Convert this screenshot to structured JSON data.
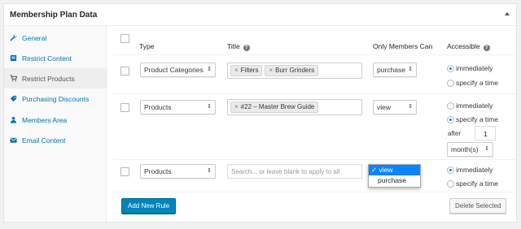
{
  "panel": {
    "title": "Membership Plan Data"
  },
  "sidebar": {
    "items": [
      {
        "label": "General",
        "icon": "wrench-icon"
      },
      {
        "label": "Restrict Content",
        "icon": "document-icon"
      },
      {
        "label": "Restrict Products",
        "icon": "cart-icon"
      },
      {
        "label": "Purchasing Discounts",
        "icon": "tag-icon"
      },
      {
        "label": "Members Area",
        "icon": "members-icon"
      },
      {
        "label": "Email Content",
        "icon": "email-icon"
      }
    ],
    "active_index": 2
  },
  "table": {
    "columns": {
      "type": "Type",
      "title": "Title",
      "only_members_can": "Only Members Can",
      "accessible": "Accessible"
    },
    "rows": [
      {
        "type": "Product Categories",
        "titles": [
          "Filters",
          "Burr Grinders"
        ],
        "only_members_can": "purchase",
        "accessible": {
          "immediately": "immediately",
          "specify": "specify a time",
          "selected": "immediately"
        }
      },
      {
        "type": "Products",
        "titles": [
          "#22 – Master Brew Guide"
        ],
        "only_members_can": "view",
        "accessible": {
          "immediately": "immediately",
          "specify": "specify a time",
          "selected": "specify a time",
          "after_label": "after",
          "after_value": "1",
          "unit": "month(s)"
        }
      },
      {
        "type": "Products",
        "title_placeholder": "Search... or leave blank to apply to all",
        "only_members_can": "view",
        "dropdown_options": [
          "view",
          "purchase"
        ],
        "dropdown_selected": "view",
        "accessible": {
          "immediately": "immediately",
          "specify": "specify a time",
          "selected": "immediately"
        }
      }
    ]
  },
  "buttons": {
    "add_new_rule": "Add New Rule",
    "delete_selected": "Delete Selected"
  },
  "colors": {
    "link": "#0073aa",
    "primary_button": "#0085ba",
    "dropdown_highlight": "#0a84ff"
  }
}
